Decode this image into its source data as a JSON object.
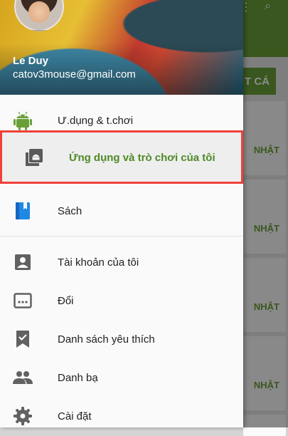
{
  "background": {
    "header_button": "T CÁ",
    "card_labels": [
      "NHẬT",
      "NHẬT",
      "NHẬT",
      "NHẬT"
    ]
  },
  "drawer": {
    "user": {
      "name": "Le Duy",
      "email": "catov3mouse@gmail.com"
    },
    "items": [
      {
        "label": "Ư.dụng & t.chơi",
        "icon": "android-icon"
      },
      {
        "label": "Ứng dụng và trò chơi của tôi",
        "icon": "my-apps-icon",
        "selected": true
      },
      {
        "label": "Sách",
        "icon": "book-icon"
      },
      {
        "label": "Tài khoản của tôi",
        "icon": "account-icon"
      },
      {
        "label": "Đổi",
        "icon": "redeem-icon"
      },
      {
        "label": "Danh sách yêu thích",
        "icon": "wishlist-icon"
      },
      {
        "label": "Danh bạ",
        "icon": "people-icon"
      },
      {
        "label": "Cài đặt",
        "icon": "settings-icon"
      }
    ]
  },
  "colors": {
    "accent_green": "#689f38",
    "highlight_border": "#f0413a",
    "books_blue": "#1e88e5"
  }
}
